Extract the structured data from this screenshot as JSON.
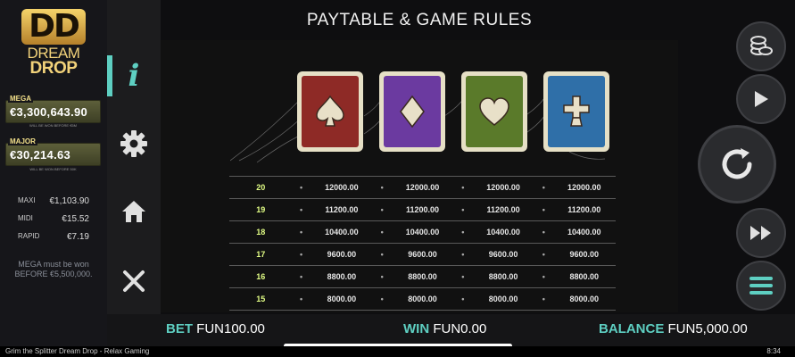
{
  "header": {
    "title": "PAYTABLE & GAME RULES"
  },
  "logo": {
    "mark": "DD",
    "line1": "DREAM",
    "line2": "DROP"
  },
  "jackpots": {
    "mega": {
      "label": "MEGA",
      "amount": "€3,300,643.90",
      "note": "WILL BE WON BEFORE €5M"
    },
    "major": {
      "label": "MAJOR",
      "amount": "€30,214.63",
      "note": "WILL BE WON BEFORE 50K"
    },
    "minor": [
      {
        "name": "MAXI",
        "value": "€1,103.90"
      },
      {
        "name": "MIDI",
        "value": "€15.52"
      },
      {
        "name": "RAPID",
        "value": "€7.19"
      }
    ],
    "mega_note": "MEGA must be won BEFORE €5,500,000."
  },
  "side_menu": {
    "items": [
      {
        "name": "info",
        "icon": "info-icon",
        "active": true
      },
      {
        "name": "settings",
        "icon": "gear-icon",
        "active": false
      },
      {
        "name": "home",
        "icon": "home-icon",
        "active": false
      },
      {
        "name": "close",
        "icon": "close-icon",
        "active": false
      }
    ]
  },
  "symbols": [
    {
      "suit": "spade",
      "color": "#8e2a26"
    },
    {
      "suit": "diamond",
      "color": "#6b3aa0"
    },
    {
      "suit": "heart",
      "color": "#5a7a2a"
    },
    {
      "suit": "club",
      "color": "#2f6fa8"
    }
  ],
  "paytable": [
    {
      "count": "20",
      "values": [
        "12000.00",
        "12000.00",
        "12000.00",
        "12000.00"
      ]
    },
    {
      "count": "19",
      "values": [
        "11200.00",
        "11200.00",
        "11200.00",
        "11200.00"
      ]
    },
    {
      "count": "18",
      "values": [
        "10400.00",
        "10400.00",
        "10400.00",
        "10400.00"
      ]
    },
    {
      "count": "17",
      "values": [
        "9600.00",
        "9600.00",
        "9600.00",
        "9600.00"
      ]
    },
    {
      "count": "16",
      "values": [
        "8800.00",
        "8800.00",
        "8800.00",
        "8800.00"
      ]
    },
    {
      "count": "15",
      "values": [
        "8000.00",
        "8000.00",
        "8000.00",
        "8000.00"
      ]
    }
  ],
  "controls": {
    "items": [
      "coins-icon",
      "play-icon",
      "spin-icon",
      "fast-forward-icon",
      "menu-icon"
    ]
  },
  "footer": {
    "bet_label": "BET",
    "bet_value": "FUN100.00",
    "win_label": "WIN",
    "win_value": "FUN0.00",
    "balance_label": "BALANCE",
    "balance_value": "FUN5,000.00"
  },
  "status_bar": {
    "app_title": "Grim the Splitter Dream Drop - Relax Gaming",
    "time": "8:34"
  },
  "colors": {
    "accent": "#5ecfc2",
    "count_text": "#e3ff86",
    "jackpot_box": "#5d5f3a"
  }
}
